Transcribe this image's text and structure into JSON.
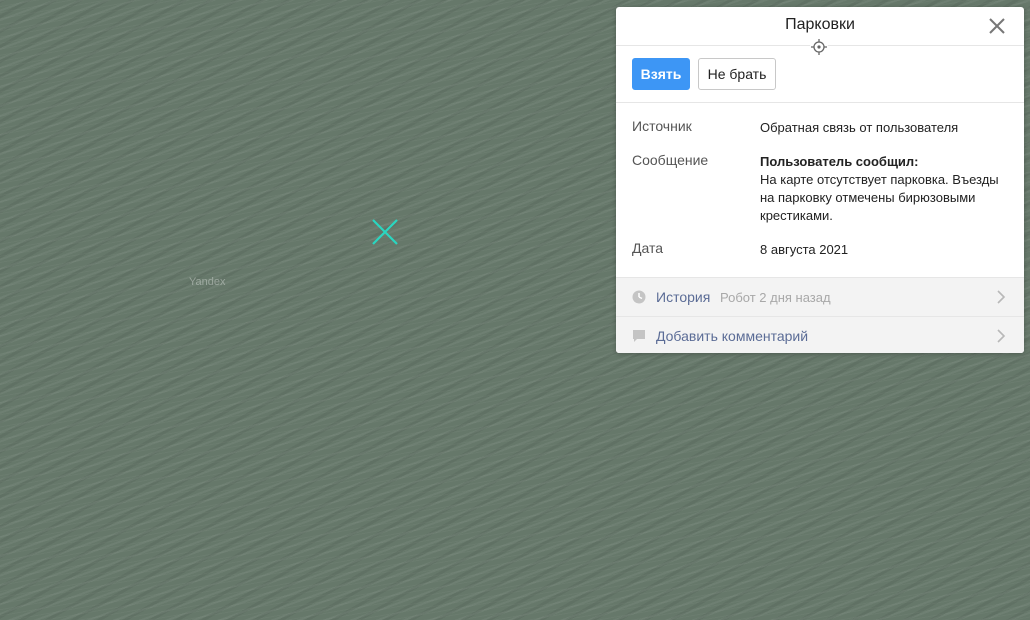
{
  "map": {
    "watermark": "Yandex",
    "marker_color": "#2ad6c0"
  },
  "panel": {
    "title": "Парковки",
    "close_icon": "close-icon",
    "locate_icon": "crosshair-icon",
    "take_label": "Взять",
    "skip_label": "Не брать",
    "fields": {
      "source_label": "Источник",
      "source_value": "Обратная связь от пользователя",
      "message_label": "Сообщение",
      "message_title": "Пользователь сообщил:",
      "message_text": "На карте отсутствует парковка. Въезды на парковку отмечены бирюзовыми крестиками.",
      "date_label": "Дата",
      "date_value": "8 августа 2021"
    },
    "history": {
      "icon": "clock-icon",
      "label": "История",
      "meta": "Робот 2 дня назад"
    },
    "comment": {
      "icon": "comment-icon",
      "label": "Добавить комментарий"
    }
  },
  "colors": {
    "primary": "#3d96f5",
    "link": "#5b6c96",
    "marker": "#2ad6c0"
  }
}
